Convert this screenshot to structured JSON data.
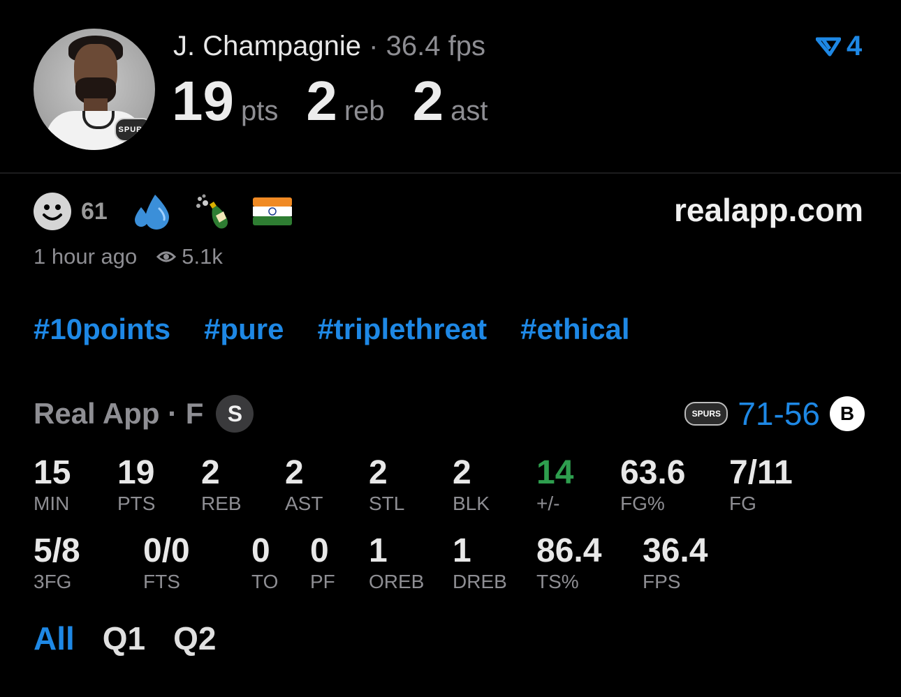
{
  "player": {
    "name": "J. Champagnie",
    "separator": "·",
    "fps_text": "36.4 fps",
    "team_badge": "SPURS"
  },
  "headline_stats": [
    {
      "value": "19",
      "unit": "pts"
    },
    {
      "value": "2",
      "unit": "reb"
    },
    {
      "value": "2",
      "unit": "ast"
    }
  ],
  "rank": {
    "icon": "upvote-chevron-icon",
    "value": "4"
  },
  "reactions": {
    "count": "61",
    "emojis": [
      "sweat-droplets-emoji",
      "champagne-emoji",
      "india-flag-emoji"
    ]
  },
  "brand": "realapp.com",
  "meta": {
    "time": "1 hour ago",
    "views": "5.1k"
  },
  "tags": [
    "#10points",
    "#pure",
    "#triplethreat",
    "#ethical"
  ],
  "game": {
    "source": "Real App · F",
    "position": "S",
    "home_badge": "SPURS",
    "score_home": "71",
    "score_dash": "-",
    "score_away": "56",
    "away_badge": "B"
  },
  "stats_row1": [
    {
      "value": "15",
      "label": "MIN"
    },
    {
      "value": "19",
      "label": "PTS"
    },
    {
      "value": "2",
      "label": "REB"
    },
    {
      "value": "2",
      "label": "AST"
    },
    {
      "value": "2",
      "label": "STL"
    },
    {
      "value": "2",
      "label": "BLK"
    },
    {
      "value": "14",
      "label": "+/-"
    },
    {
      "value": "63.6",
      "label": "FG%"
    },
    {
      "value": "7/11",
      "label": "FG"
    }
  ],
  "stats_row2": [
    {
      "value": "5/8",
      "label": "3FG"
    },
    {
      "value": "0/0",
      "label": "FTS"
    },
    {
      "value": "0",
      "label": "TO"
    },
    {
      "value": "0",
      "label": "PF"
    },
    {
      "value": "1",
      "label": "OREB"
    },
    {
      "value": "1",
      "label": "DREB"
    },
    {
      "value": "86.4",
      "label": "TS%"
    },
    {
      "value": "36.4",
      "label": "FPS"
    }
  ],
  "periods": [
    "All",
    "Q1",
    "Q2"
  ],
  "colors": {
    "accent": "#1e88e5",
    "positive": "#2e9e4e",
    "muted": "#8e8e93"
  }
}
